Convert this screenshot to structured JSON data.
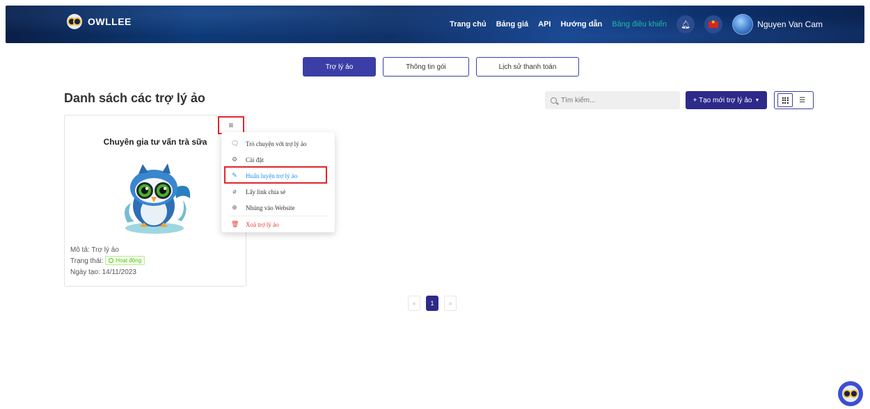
{
  "header": {
    "brand": "OWLLEE",
    "nav": [
      {
        "label": "Trang chủ",
        "active": false
      },
      {
        "label": "Bảng giá",
        "active": false
      },
      {
        "label": "API",
        "active": false
      },
      {
        "label": "Hướng dẫn",
        "active": false
      },
      {
        "label": "Bảng điều khiển",
        "active": true
      }
    ],
    "user_name": "Nguyen Van Cam"
  },
  "tabs": [
    {
      "label": "Trợ lý ảo",
      "active": true
    },
    {
      "label": "Thông tin gói",
      "active": false
    },
    {
      "label": "Lịch sử thanh toán",
      "active": false
    }
  ],
  "main": {
    "title": "Danh sách các trợ lý ảo",
    "search_placeholder": "Tìm kiếm...",
    "create_label": "+ Tạo mới trợ lý ảo"
  },
  "card": {
    "title": "Chuyên gia tư vấn trà sữa",
    "description": "Mô tả: Trợ lý ảo",
    "status_label": "Trạng thái:",
    "status_value": "Hoạt động",
    "created": "Ngày tạo: 14/11/2023"
  },
  "dropdown": {
    "items": [
      {
        "label": "Trò chuyện với trợ lý ảo",
        "icon": "chat-icon"
      },
      {
        "label": "Cài đặt",
        "icon": "gear-icon"
      },
      {
        "label": "Huấn luyện trợ lý ảo",
        "icon": "train-icon",
        "highlight": true
      },
      {
        "label": "Lấy link chia sẻ",
        "icon": "paperclip-icon"
      },
      {
        "label": "Nhúng vào Website",
        "icon": "globe-icon"
      },
      {
        "label": "Xoá trợ lý ảo",
        "icon": "trash-icon",
        "danger": true
      }
    ]
  },
  "pagination": {
    "prev": "«",
    "current": "1",
    "next": "»"
  },
  "colors": {
    "primary": "#2d2a8a",
    "active_nav": "#1fb8a6",
    "highlight": "#e0262b",
    "success": "#52c41a",
    "danger": "#e53935"
  }
}
